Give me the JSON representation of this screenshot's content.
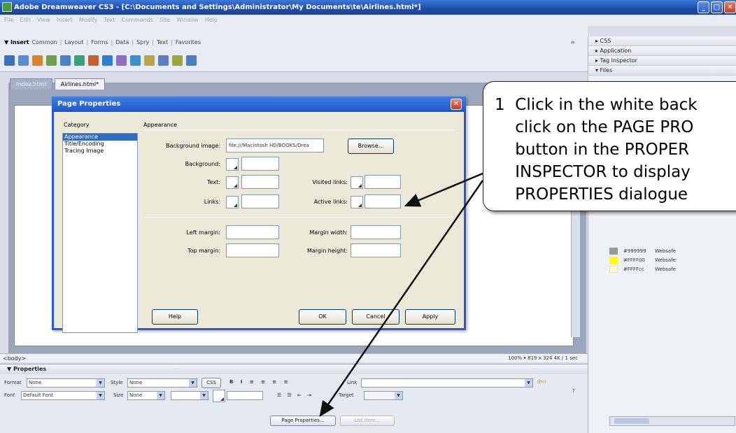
{
  "window": {
    "title": "Adobe Dreamweaver CS3 - [C:\\Documents and Settings\\Administrator\\My Documents\\te\\Airlines.html*]",
    "controls": [
      "_",
      "□",
      "✕"
    ]
  },
  "menubar": [
    "File",
    "Edit",
    "View",
    "Insert",
    "Modify",
    "Text",
    "Commands",
    "Site",
    "Window",
    "Help"
  ],
  "insert_bar": {
    "title": "▼ Insert",
    "tabs": [
      "Common",
      "Layout",
      "Forms",
      "Data",
      "Spry",
      "Text",
      "Favorites"
    ],
    "icon_colors": [
      "#3d6fbf",
      "#5a8ad0",
      "#d9822b",
      "#6f9f4f",
      "#4a82c6",
      "#3aa07a",
      "#c45f30",
      "#2f7fd0",
      "#8f6fbf",
      "#3e8fd0",
      "#b8a44a",
      "#5c7ec4",
      "#9aa63a",
      "#4e7fbd"
    ]
  },
  "document": {
    "tabs": [
      "Index.html",
      "Airlines.html*"
    ],
    "status_tag": "<body>",
    "status_right": "100%  ▾  819 x 324  4K / 1 sec"
  },
  "right_panels": {
    "rows": [
      "▸ CSS",
      "▸ Application",
      "▸ Tag Inspector",
      "▾ Files"
    ],
    "colors": [
      {
        "hex": "#999999",
        "type": "Websafe",
        "swatch": "#999999"
      },
      {
        "hex": "#FFFF00",
        "type": "Websafe",
        "swatch": "#ffff00"
      },
      {
        "hex": "#FFFFcc",
        "type": "Websafe",
        "swatch": "#ffffcc"
      }
    ]
  },
  "properties": {
    "title": "▼ Properties",
    "format_label": "Format",
    "format_value": "None",
    "style_label": "Style",
    "style_value": "None",
    "css_label": "CSS",
    "font_label": "Font",
    "font_value": "Default Font",
    "size_label": "Size",
    "size_value": "None",
    "link_label": "Link",
    "target_label": "Target",
    "page_properties": "Page Properties...",
    "list_item": "List Item..."
  },
  "dialog": {
    "title": "Page Properties",
    "category_label": "Category",
    "categories": [
      "Appearance",
      "Title/Encoding",
      "Tracing Image"
    ],
    "section_label": "Appearance",
    "bg_image_label": "Background image:",
    "bg_image_value": "file:///Macintosh HD/BOOKS/Drea",
    "browse": "Browse...",
    "background_label": "Background:",
    "text_label": "Text:",
    "visited_label": "Visited links:",
    "links_label": "Links:",
    "active_label": "Active links:",
    "left_margin_label": "Left margin:",
    "margin_width_label": "Margin width:",
    "top_margin_label": "Top margin:",
    "margin_height_label": "Margin height:",
    "help": "Help",
    "ok": "OK",
    "cancel": "Cancel",
    "apply": "Apply"
  },
  "callout": {
    "text": "1  Click in the white back\n    click on the PAGE PRO\n    button in the PROPER\n    INSPECTOR to display\n    PROPERTIES dialogue"
  }
}
